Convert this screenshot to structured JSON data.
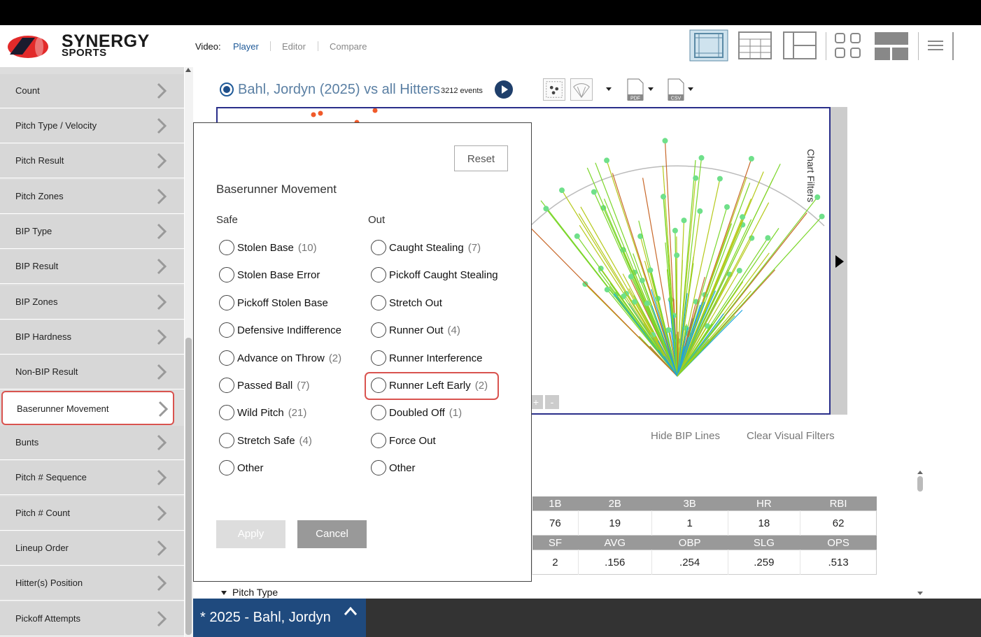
{
  "brand": {
    "line1": "SYNERGY",
    "line2": "SPORTS"
  },
  "video": {
    "label": "Video:",
    "player": "Player",
    "editor": "Editor",
    "compare": "Compare"
  },
  "sidebar": {
    "items": [
      {
        "label": "Count"
      },
      {
        "label": "Pitch Type / Velocity"
      },
      {
        "label": "Pitch Result"
      },
      {
        "label": "Pitch Zones"
      },
      {
        "label": "BIP Type"
      },
      {
        "label": "BIP Result"
      },
      {
        "label": "BIP Zones"
      },
      {
        "label": "BIP Hardness"
      },
      {
        "label": "Non-BIP Result"
      },
      {
        "label": "Baserunner Movement"
      },
      {
        "label": "Bunts"
      },
      {
        "label": "Pitch # Sequence"
      },
      {
        "label": "Pitch # Count"
      },
      {
        "label": "Lineup Order"
      },
      {
        "label": "Hitter(s) Position"
      },
      {
        "label": "Pickoff Attempts"
      }
    ]
  },
  "panel": {
    "title": "Bahl, Jordyn (2025) vs all Hitters",
    "events": "3212 events"
  },
  "tools": {
    "pdf": "PDF",
    "csv": "CSV"
  },
  "chart": {
    "filters_label": "Chart Filters",
    "zoom_in": "+",
    "zoom_out": "-",
    "hide_bip": "Hide BIP Lines",
    "clear_filters": "Clear Visual Filters"
  },
  "stats": {
    "row1_headers": [
      "1B",
      "2B",
      "3B",
      "HR",
      "RBI"
    ],
    "row1_values": [
      "76",
      "19",
      "1",
      "18",
      "62"
    ],
    "row2_headers": [
      "SF",
      "AVG",
      "OBP",
      "SLG",
      "OPS"
    ],
    "row2_values": [
      "2",
      ".156",
      ".254",
      ".259",
      ".513"
    ]
  },
  "pitch_type": "Pitch Type",
  "bottom_tab": "* 2025 - Bahl, Jordyn",
  "modal": {
    "reset": "Reset",
    "title": "Baserunner Movement",
    "safe_header": "Safe",
    "out_header": "Out",
    "safe": [
      {
        "label": "Stolen Base",
        "count": "(10)"
      },
      {
        "label": "Stolen Base Error",
        "count": ""
      },
      {
        "label": "Pickoff Stolen Base",
        "count": ""
      },
      {
        "label": "Defensive Indifference",
        "count": ""
      },
      {
        "label": "Advance on Throw",
        "count": "(2)"
      },
      {
        "label": "Passed Ball",
        "count": "(7)"
      },
      {
        "label": "Wild Pitch",
        "count": "(21)"
      },
      {
        "label": "Stretch Safe",
        "count": "(4)"
      },
      {
        "label": "Other",
        "count": ""
      }
    ],
    "out": [
      {
        "label": "Caught Stealing",
        "count": "(7)"
      },
      {
        "label": "Pickoff Caught Stealing",
        "count": ""
      },
      {
        "label": "Stretch Out",
        "count": ""
      },
      {
        "label": "Runner Out",
        "count": "(4)"
      },
      {
        "label": "Runner Interference",
        "count": ""
      },
      {
        "label": "Runner Left Early",
        "count": "(2)"
      },
      {
        "label": "Doubled Off",
        "count": "(1)"
      },
      {
        "label": "Force Out",
        "count": ""
      },
      {
        "label": "Other",
        "count": ""
      }
    ],
    "apply": "Apply",
    "cancel": "Cancel"
  },
  "colors": {
    "accent": "#1f5a98",
    "highlight": "#d9534f",
    "chart_border": "#2a2f8a"
  }
}
